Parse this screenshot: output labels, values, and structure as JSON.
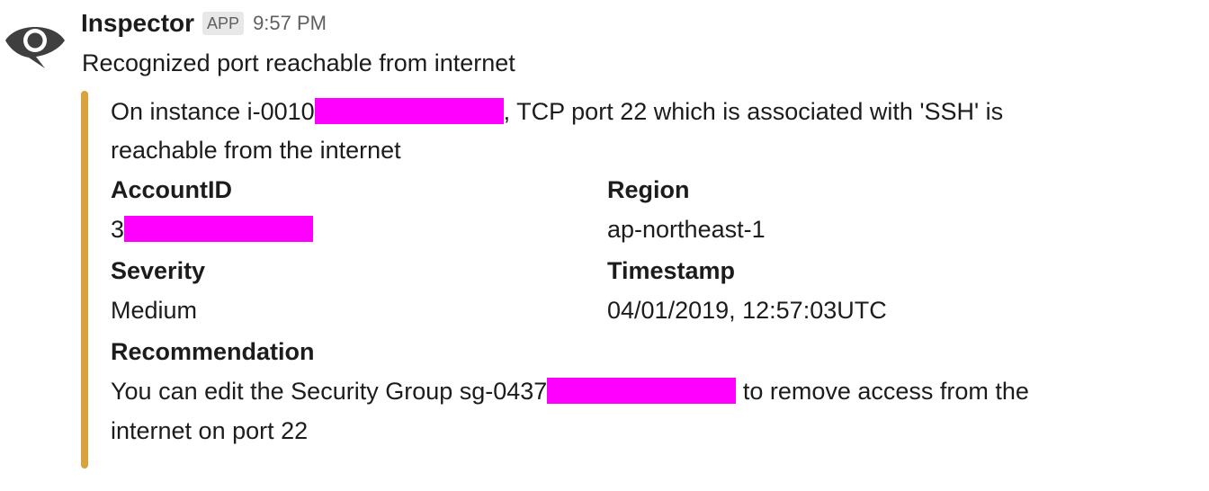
{
  "message": {
    "sender": "Inspector",
    "badge": "APP",
    "time": "9:57 PM",
    "text": "Recognized port reachable from internet",
    "avatar_icon": "eye-icon"
  },
  "attachment": {
    "color": "#d8a23c",
    "description_prefix": "On instance i-0010",
    "description_suffix": ", TCP port 22 which is associated with 'SSH' is reachable from the internet",
    "fields": {
      "account_id": {
        "title": "AccountID",
        "value_prefix": "3"
      },
      "region": {
        "title": "Region",
        "value": "ap-northeast-1"
      },
      "severity": {
        "title": "Severity",
        "value": "Medium"
      },
      "timestamp": {
        "title": "Timestamp",
        "value": "04/01/2019, 12:57:03UTC"
      },
      "recommendation": {
        "title": "Recommendation",
        "value_prefix": "You can edit the Security Group sg-0437",
        "value_suffix": " to remove access from the internet on port 22"
      }
    },
    "redaction_color": "#ff00ff"
  }
}
